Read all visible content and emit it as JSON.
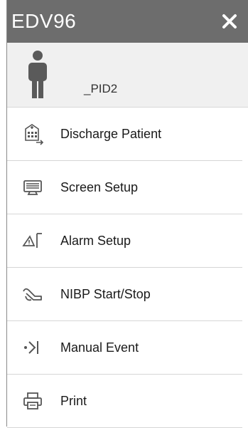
{
  "header": {
    "title": "EDV96",
    "close_icon": "close-icon"
  },
  "patient": {
    "id_label": "_PID2",
    "avatar_icon": "person-icon"
  },
  "menu": {
    "items": [
      {
        "label": "Discharge Patient",
        "icon": "discharge-patient-icon"
      },
      {
        "label": "Screen Setup",
        "icon": "monitor-icon"
      },
      {
        "label": "Alarm Setup",
        "icon": "alarm-bell-icon"
      },
      {
        "label": "NIBP Start/Stop",
        "icon": "blood-pressure-cuff-icon"
      },
      {
        "label": "Manual Event",
        "icon": "manual-event-icon"
      },
      {
        "label": "Print",
        "icon": "printer-icon"
      }
    ]
  },
  "colors": {
    "titlebar": "#6d6d6d",
    "patient_bg": "#f0f0f0",
    "icon": "#555555"
  }
}
